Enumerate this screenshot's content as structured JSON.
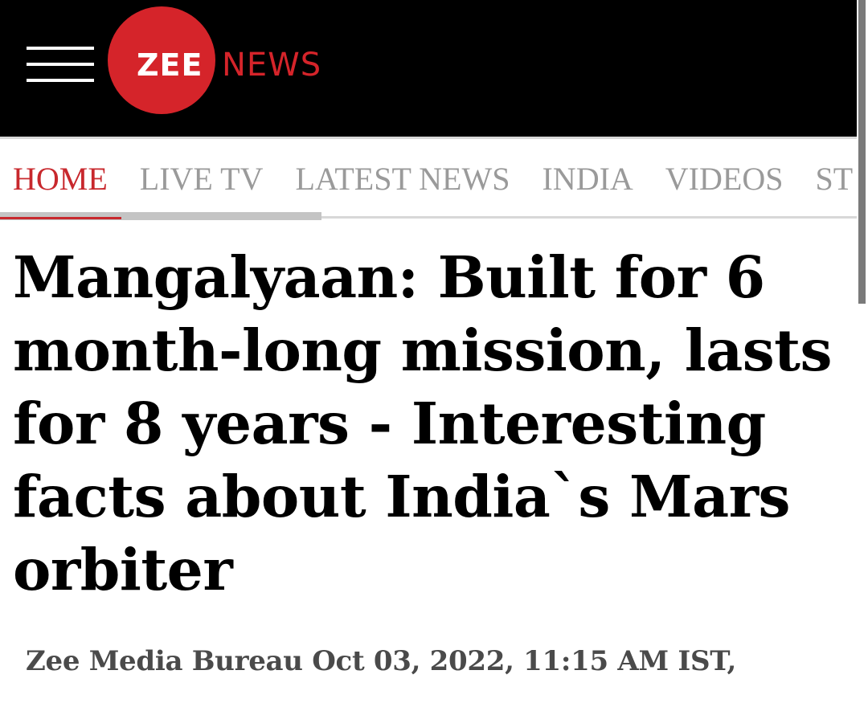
{
  "header": {
    "logo": {
      "brand_part1": "ZEE",
      "brand_part2": "NEWS"
    },
    "colors": {
      "background": "#000000",
      "logo_red": "#d5242a"
    }
  },
  "nav": {
    "items": [
      {
        "label": "HOME",
        "active": true
      },
      {
        "label": "LIVE TV",
        "active": false
      },
      {
        "label": "LATEST NEWS",
        "active": false
      },
      {
        "label": "INDIA",
        "active": false
      },
      {
        "label": "VIDEOS",
        "active": false
      },
      {
        "label": "ST",
        "active": false
      }
    ],
    "colors": {
      "active": "#c8282d",
      "inactive": "#9a9a9a"
    }
  },
  "article": {
    "headline": "Mangalyaan: Built for 6 month-long mission, lasts for 8 years - Interesting facts about India`s Mars orbiter",
    "byline": "Zee Media Bureau Oct 03, 2022, 11:15 AM IST,"
  },
  "icons": {
    "menu": "hamburger-menu-icon"
  }
}
